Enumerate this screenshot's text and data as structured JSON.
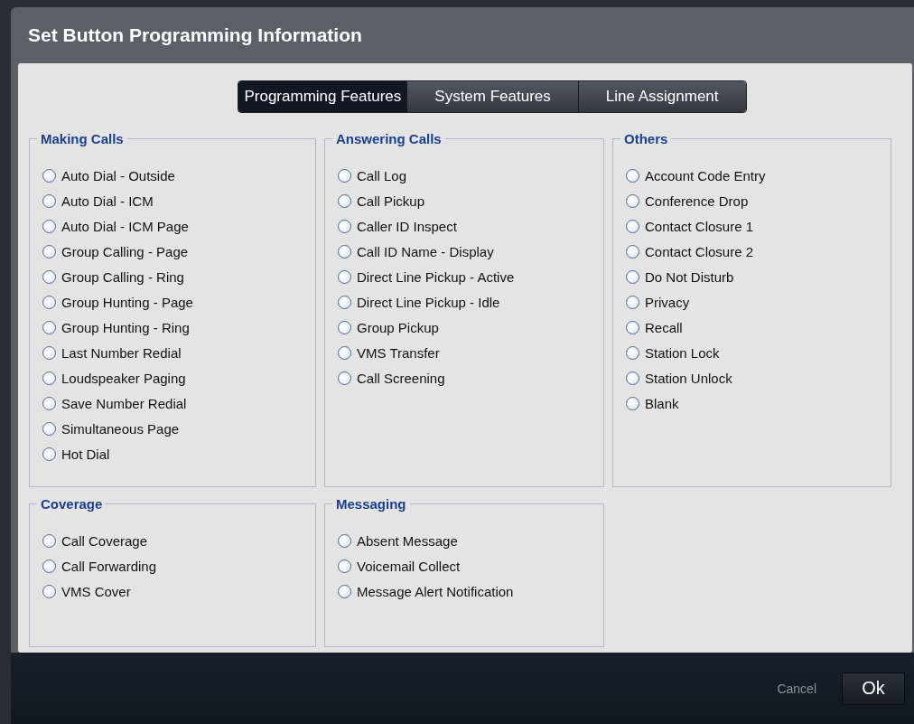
{
  "window": {
    "title": "Set Button Programming Information"
  },
  "tabs": [
    {
      "label": "Programming Features",
      "selected": true
    },
    {
      "label": "System Features",
      "selected": false
    },
    {
      "label": "Line Assignment",
      "selected": false
    }
  ],
  "groups": [
    {
      "title": "Making Calls",
      "options": [
        {
          "label": "Auto Dial - Outside",
          "selected": false
        },
        {
          "label": "Auto Dial - ICM",
          "selected": false
        },
        {
          "label": "Auto Dial - ICM Page",
          "selected": false
        },
        {
          "label": "Group Calling - Page",
          "selected": false
        },
        {
          "label": "Group Calling - Ring",
          "selected": false
        },
        {
          "label": "Group Hunting - Page",
          "selected": false
        },
        {
          "label": "Group Hunting - Ring",
          "selected": false
        },
        {
          "label": "Last Number Redial",
          "selected": false
        },
        {
          "label": "Loudspeaker Paging",
          "selected": false
        },
        {
          "label": "Save Number Redial",
          "selected": false
        },
        {
          "label": "Simultaneous Page",
          "selected": false
        },
        {
          "label": "Hot Dial",
          "selected": false
        }
      ]
    },
    {
      "title": "Answering Calls",
      "options": [
        {
          "label": "Call Log",
          "selected": false
        },
        {
          "label": "Call Pickup",
          "selected": false
        },
        {
          "label": "Caller ID Inspect",
          "selected": false
        },
        {
          "label": "Call ID Name - Display",
          "selected": false
        },
        {
          "label": "Direct Line Pickup - Active",
          "selected": false
        },
        {
          "label": "Direct Line Pickup - Idle",
          "selected": false
        },
        {
          "label": "Group Pickup",
          "selected": false
        },
        {
          "label": "VMS Transfer",
          "selected": false
        },
        {
          "label": "Call Screening",
          "selected": false
        }
      ]
    },
    {
      "title": "Others",
      "options": [
        {
          "label": "Account Code Entry",
          "selected": false
        },
        {
          "label": "Conference Drop",
          "selected": false
        },
        {
          "label": "Contact Closure 1",
          "selected": false
        },
        {
          "label": "Contact Closure 2",
          "selected": false
        },
        {
          "label": "Do Not Disturb",
          "selected": false
        },
        {
          "label": "Privacy",
          "selected": false
        },
        {
          "label": "Recall",
          "selected": false
        },
        {
          "label": "Station Lock",
          "selected": false
        },
        {
          "label": "Station Unlock",
          "selected": false
        },
        {
          "label": "Blank",
          "selected": false
        }
      ]
    },
    {
      "title": "Coverage",
      "options": [
        {
          "label": "Call Coverage",
          "selected": false
        },
        {
          "label": "Call Forwarding",
          "selected": false
        },
        {
          "label": "VMS Cover",
          "selected": false
        }
      ]
    },
    {
      "title": "Messaging",
      "options": [
        {
          "label": "Absent Message",
          "selected": false
        },
        {
          "label": "Voicemail Collect",
          "selected": false
        },
        {
          "label": "Message Alert Notification",
          "selected": false
        }
      ]
    }
  ],
  "buttons": {
    "cancel": "Cancel",
    "ok": "Ok"
  }
}
